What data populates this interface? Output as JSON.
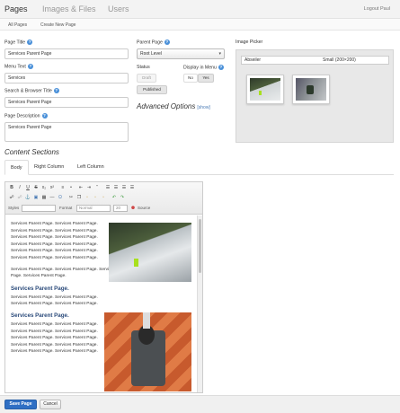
{
  "nav": {
    "tabs": [
      {
        "label": "Pages"
      },
      {
        "label": "Images & Files"
      },
      {
        "label": "Users"
      }
    ],
    "logout": "Logout Paul"
  },
  "subnav": {
    "all_pages": "All Pages",
    "create_new": "Create New Page"
  },
  "form": {
    "page_title_label": "Page Title",
    "page_title_value": "Services Parent Page",
    "menu_text_label": "Menu Text",
    "menu_text_value": "Services",
    "search_title_label": "Search & Browser Title",
    "search_title_value": "Services Parent Page",
    "description_label": "Page Description",
    "description_value": "Services Parent Page",
    "parent_page_label": "Parent Page",
    "parent_page_value": "Root Level",
    "status_label": "Status",
    "status_draft": "Draft",
    "status_published": "Published",
    "display_label": "Display in Menu",
    "display_no": "No",
    "display_yes": "Yes",
    "advanced_label": "Advanced Options",
    "advanced_show": "[show]",
    "image_picker_label": "Image Picker",
    "picker_left": "Abseiler",
    "picker_right": "Small (200×200)"
  },
  "content_sections": {
    "title": "Content Sections",
    "tabs": [
      "Body",
      "Right Column",
      "Left Column"
    ]
  },
  "editor": {
    "styles_label": "Styles",
    "format_label": "Format",
    "format_value": "Normal",
    "size_value": "20",
    "source_label": "Source",
    "para1": "Services Parent Page. Services Parent Page. Services Parent Page. Services Parent Page. Services Parent Page. Services Parent Page. Services Parent Page. Services Parent Page. Services Parent Page. Services Parent Page. Services Parent Page. Services Parent Page.",
    "para2": "Services Parent Page. Services Parent Page. Services Parent Page. Services Parent Page.",
    "heading1": "Services Parent Page.",
    "para3": "Services Parent Page. Services Parent Page. Services Parent Page. Services Parent Page.",
    "heading2": "Services Parent Page.",
    "para4": "Services Parent Page. Services Parent Page. Services Parent Page. Services Parent Page. Services Parent Page. Services Parent Page. Services Parent Page. Services Parent Page. Services Parent Page. Services Parent Page."
  },
  "footer": {
    "save": "Save Page",
    "cancel": "Cancel"
  },
  "colors": {
    "accent": "#2f6fc4",
    "help_icon": "#4a90d9"
  }
}
